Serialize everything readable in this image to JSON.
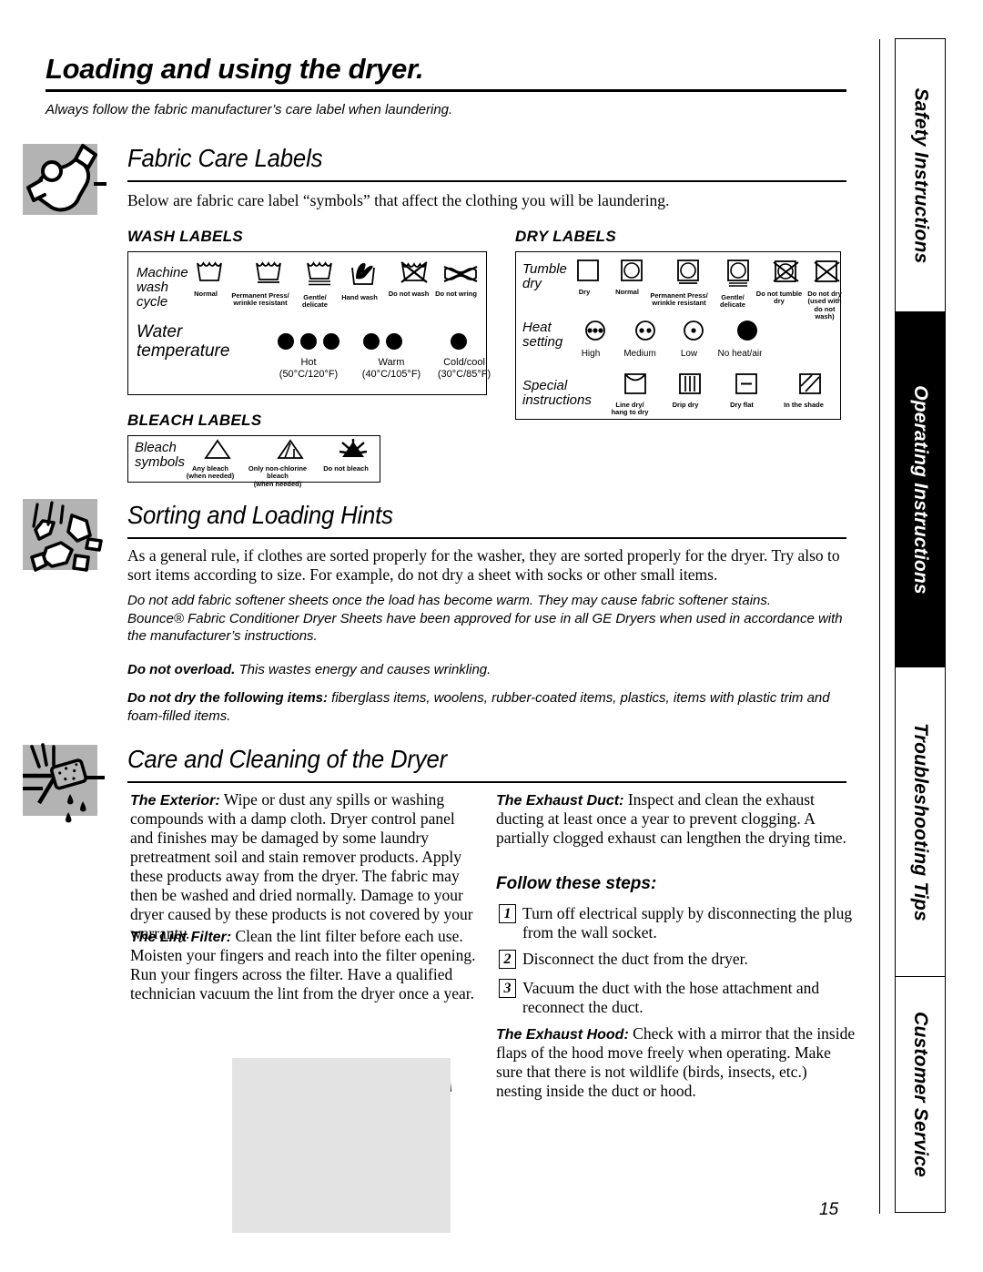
{
  "page": {
    "title": "Loading and using the dryer.",
    "subtitle": "Always follow the fabric manufacturer’s care label when laundering.",
    "number": "15"
  },
  "sidebar": {
    "tabs": [
      {
        "label": "Safety Instructions",
        "active": false
      },
      {
        "label": "Operating Instructions",
        "active": true
      },
      {
        "label": "Troubleshooting Tips",
        "active": false
      },
      {
        "label": "Customer Service",
        "active": false
      }
    ]
  },
  "sections": {
    "fabric_care": {
      "heading": "Fabric Care Labels",
      "icon": "folded-shirt-icon",
      "intro": "Below are fabric care label “symbols” that affect the clothing you will be laundering.",
      "wash": {
        "title": "WASH LABELS",
        "row1_label": "Machine\nwash\ncycle",
        "row1_symbols": [
          {
            "name": "washtub-normal-icon",
            "caption": "Normal"
          },
          {
            "name": "washtub-permanent-press-icon",
            "caption": "Permanent Press/\nwrinkle resistant"
          },
          {
            "name": "washtub-gentle-icon",
            "caption": "Gentle/\ndelicate"
          },
          {
            "name": "washtub-hand-wash-icon",
            "caption": "Hand wash"
          },
          {
            "name": "washtub-do-not-wash-icon",
            "caption": "Do not wash"
          },
          {
            "name": "do-not-wring-icon",
            "caption": "Do not wring"
          }
        ],
        "row2_label": "Water\ntemperature",
        "row2_symbols": [
          {
            "name": "dots-hot-icon",
            "dots": 3,
            "caption": "Hot\n(50°C/120°F)"
          },
          {
            "name": "dots-warm-icon",
            "dots": 2,
            "caption": "Warm\n(40°C/105°F)"
          },
          {
            "name": "dots-cold-icon",
            "dots": 1,
            "caption": "Cold/cool\n(30°C/85°F)"
          }
        ]
      },
      "bleach": {
        "title": "BLEACH LABELS",
        "row_label": "Bleach\nsymbols",
        "symbols": [
          {
            "name": "triangle-any-bleach-icon",
            "caption": "Any bleach\n(when needed)"
          },
          {
            "name": "triangle-non-chlorine-bleach-icon",
            "caption": "Only non-chlorine bleach\n(when needed)"
          },
          {
            "name": "triangle-do-not-bleach-icon",
            "caption": "Do not bleach"
          }
        ]
      },
      "dry": {
        "title": "DRY LABELS",
        "row1_label": "Tumble\ndry",
        "row1_symbols": [
          {
            "name": "square-dry-icon",
            "caption": "Dry"
          },
          {
            "name": "square-normal-icon",
            "caption": "Normal"
          },
          {
            "name": "square-permanent-press-icon",
            "caption": "Permanent Press/\nwrinkle resistant"
          },
          {
            "name": "square-gentle-icon",
            "caption": "Gentle/\ndelicate"
          },
          {
            "name": "square-do-not-tumble-dry-icon",
            "caption": "Do not tumble dry"
          },
          {
            "name": "square-do-not-dry-icon",
            "caption": "Do not dry\n(used with\ndo not wash)"
          }
        ],
        "row2_label": "Heat\nsetting",
        "row2_symbols": [
          {
            "name": "circle-high-heat-icon",
            "caption": "High"
          },
          {
            "name": "circle-medium-heat-icon",
            "caption": "Medium"
          },
          {
            "name": "circle-low-heat-icon",
            "caption": "Low"
          },
          {
            "name": "circle-no-heat-icon",
            "caption": "No heat/air"
          }
        ],
        "row3_label": "Special\ninstructions",
        "row3_symbols": [
          {
            "name": "line-dry-icon",
            "caption": "Line dry/\nhang to dry"
          },
          {
            "name": "drip-dry-icon",
            "caption": "Drip dry"
          },
          {
            "name": "dry-flat-icon",
            "caption": "Dry flat"
          },
          {
            "name": "in-the-shade-icon",
            "caption": "In the shade"
          }
        ]
      }
    },
    "sorting": {
      "heading": "Sorting and Loading Hints",
      "icon": "tumbling-clothes-icon",
      "p1": "As a general rule, if clothes are sorted properly for the washer, they are sorted properly for the dryer. Try also to sort items according to size. For example, do not dry a sheet with socks or other small items.",
      "p2_line1": "Do not add fabric softener sheets once the load has become warm. They may cause fabric softener stains.",
      "p2_line2": "Bounce® Fabric Conditioner Dryer Sheets have been approved for use in all GE Dryers when used in accordance with the manufacturer’s instructions.",
      "p3_bold": "Do not overload.",
      "p3_rest": " This wastes energy and causes wrinkling.",
      "p4_bold": "Do not dry the following items:",
      "p4_rest": " fiberglass items, woolens, rubber-coated items, plastics, items with plastic trim and foam-filled items."
    },
    "care": {
      "heading": "Care and Cleaning of the Dryer",
      "icon": "wiping-sponge-icon",
      "left": {
        "exterior_bold": "The Exterior:",
        "exterior_rest": " Wipe or dust any spills or washing compounds with a damp cloth. Dryer control panel and finishes may be damaged by some laundry pretreatment soil and stain remover products. Apply these products away from the dryer. The fabric may then be washed and dried normally. Damage to your dryer caused by these products is not covered by your warranty.",
        "lint_bold": "The Lint Filter:",
        "lint_rest": " Clean the lint filter before each use. Moisten your fingers and reach into the filter opening. Run your fingers across the filter. Have a qualified technician vacuum the lint from the dryer once a year.",
        "illustration": "dryer-lint-filter-illustration"
      },
      "right": {
        "duct_bold": "The Exhaust Duct:",
        "duct_rest": " Inspect and clean the exhaust ducting at least once a year to prevent clogging. A partially clogged exhaust can lengthen the drying time.",
        "steps_heading": "Follow these steps:",
        "steps": [
          {
            "num": "1",
            "text": "Turn off electrical supply by disconnecting the plug from the wall socket."
          },
          {
            "num": "2",
            "text": "Disconnect the duct from the dryer."
          },
          {
            "num": "3",
            "text": "Vacuum the duct with the hose attachment and reconnect the duct."
          }
        ],
        "hood_bold": "The Exhaust Hood:",
        "hood_rest": " Check with a mirror that the inside flaps of the hood move freely when operating. Make sure that there is not wildlife (birds, insects, etc.) nesting inside the duct or hood."
      }
    }
  },
  "colors": {
    "icon_box": "#b3b3b3",
    "illustration_bg": "#e3e3e3",
    "active_tab_bg": "#000000",
    "ink": "#000000"
  }
}
